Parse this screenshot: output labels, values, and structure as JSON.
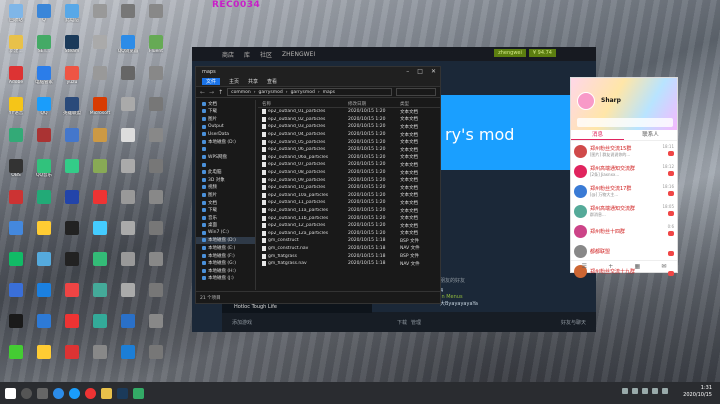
{
  "recording_label": "REC0034",
  "desktop_icons": [
    {
      "label": "回收站",
      "icon": "recycle-bin-icon",
      "color": "#7fb6e8"
    },
    {
      "label": "Q",
      "icon": "app-icon",
      "color": "#3a86d9"
    },
    {
      "label": "此电脑",
      "icon": "this-pc-icon",
      "color": "#58a8e8"
    },
    {
      "label": "",
      "icon": "app-icon",
      "color": "#999"
    },
    {
      "label": "",
      "icon": "app-icon",
      "color": "#777"
    },
    {
      "label": "",
      "icon": "app-icon",
      "color": "#888"
    },
    {
      "label": "新建...",
      "icon": "folder-icon",
      "color": "#e8c14a"
    },
    {
      "label": "SET...",
      "icon": "app-icon",
      "color": "#4a6"
    },
    {
      "label": "Steam",
      "icon": "steam-icon",
      "color": "#1b3a5a"
    },
    {
      "label": "",
      "icon": "app-icon",
      "color": "#aaa"
    },
    {
      "label": "QQ浏览器",
      "icon": "browser-icon",
      "color": "#2c8ce8"
    },
    {
      "label": "Fluent",
      "icon": "app-icon",
      "color": "#6a5"
    },
    {
      "label": "Adobe",
      "icon": "adobe-icon",
      "color": "#d33"
    },
    {
      "label": "电脑管家",
      "icon": "app-icon",
      "color": "#2b7de9"
    },
    {
      "label": "yuzu",
      "icon": "app-icon",
      "color": "#e54"
    },
    {
      "label": "",
      "icon": "app-icon",
      "color": "#999"
    },
    {
      "label": "",
      "icon": "app-icon",
      "color": "#666"
    },
    {
      "label": "",
      "icon": "app-icon",
      "color": "#888"
    },
    {
      "label": "YY语音",
      "icon": "app-icon",
      "color": "#f5c518"
    },
    {
      "label": "QQ",
      "icon": "qq-icon",
      "color": "#1a9dfb"
    },
    {
      "label": "英雄联盟",
      "icon": "game-icon",
      "color": "#2a4a7a"
    },
    {
      "label": "Microsoft",
      "icon": "app-icon",
      "color": "#d83b01"
    },
    {
      "label": "",
      "icon": "app-icon",
      "color": "#aaa"
    },
    {
      "label": "",
      "icon": "app-icon",
      "color": "#777"
    },
    {
      "label": "",
      "icon": "app-icon",
      "color": "#3a7"
    },
    {
      "label": "",
      "icon": "app-icon",
      "color": "#a33"
    },
    {
      "label": "",
      "icon": "app-icon",
      "color": "#47c"
    },
    {
      "label": "",
      "icon": "app-icon",
      "color": "#c94"
    },
    {
      "label": "",
      "icon": "app-icon",
      "color": "#ddd"
    },
    {
      "label": "",
      "icon": "app-icon",
      "color": "#888"
    },
    {
      "label": "OBS",
      "icon": "obs-icon",
      "color": "#333"
    },
    {
      "label": "QQ音乐",
      "icon": "music-icon",
      "color": "#31c27c"
    },
    {
      "label": "",
      "icon": "app-icon",
      "color": "#3c8"
    },
    {
      "label": "",
      "icon": "app-icon",
      "color": "#8a5"
    },
    {
      "label": "",
      "icon": "app-icon",
      "color": "#aaa"
    },
    {
      "label": "",
      "icon": "app-icon",
      "color": "#777"
    },
    {
      "label": "",
      "icon": "app-icon",
      "color": "#c33"
    },
    {
      "label": "",
      "icon": "app-icon",
      "color": "#2a7"
    },
    {
      "label": "",
      "icon": "app-icon",
      "color": "#24a"
    },
    {
      "label": "",
      "icon": "app-icon",
      "color": "#e33"
    },
    {
      "label": "",
      "icon": "app-icon",
      "color": "#999"
    },
    {
      "label": "",
      "icon": "app-icon",
      "color": "#888"
    },
    {
      "label": "",
      "icon": "app-icon",
      "color": "#48d"
    },
    {
      "label": "",
      "icon": "app-icon",
      "color": "#fc3"
    },
    {
      "label": "",
      "icon": "app-icon",
      "color": "#222"
    },
    {
      "label": "",
      "icon": "app-icon",
      "color": "#4cf"
    },
    {
      "label": "",
      "icon": "app-icon",
      "color": "#aaa"
    },
    {
      "label": "",
      "icon": "app-icon",
      "color": "#777"
    },
    {
      "label": "",
      "icon": "app-icon",
      "color": "#1b6"
    },
    {
      "label": "",
      "icon": "app-icon",
      "color": "#5ad"
    },
    {
      "label": "",
      "icon": "app-icon",
      "color": "#222"
    },
    {
      "label": "",
      "icon": "app-icon",
      "color": "#3b7"
    },
    {
      "label": "",
      "icon": "app-icon",
      "color": "#999"
    },
    {
      "label": "",
      "icon": "app-icon",
      "color": "#888"
    },
    {
      "label": "",
      "icon": "app-icon",
      "color": "#3a6fd8"
    },
    {
      "label": "",
      "icon": "app-icon",
      "color": "#1b80e0"
    },
    {
      "label": "",
      "icon": "app-icon",
      "color": "#e44"
    },
    {
      "label": "",
      "icon": "app-icon",
      "color": "#4a9"
    },
    {
      "label": "",
      "icon": "app-icon",
      "color": "#aaa"
    },
    {
      "label": "",
      "icon": "app-icon",
      "color": "#777"
    },
    {
      "label": "",
      "icon": "app-icon",
      "color": "#1a1a1a"
    },
    {
      "label": "",
      "icon": "app-icon",
      "color": "#2d7ad6"
    },
    {
      "label": "",
      "icon": "app-icon",
      "color": "#e33"
    },
    {
      "label": "",
      "icon": "app-icon",
      "color": "#3a9"
    },
    {
      "label": "",
      "icon": "app-icon",
      "color": "#2a70c8"
    },
    {
      "label": "",
      "icon": "app-icon",
      "color": "#888"
    },
    {
      "label": "",
      "icon": "app-icon",
      "color": "#4c3"
    },
    {
      "label": "",
      "icon": "app-icon",
      "color": "#fc3"
    },
    {
      "label": "",
      "icon": "app-icon",
      "color": "#d33"
    },
    {
      "label": "",
      "icon": "app-icon",
      "color": "#888"
    },
    {
      "label": "",
      "icon": "app-icon",
      "color": "#1c7ed6"
    },
    {
      "label": "",
      "icon": "app-icon",
      "color": "#777"
    }
  ],
  "steam": {
    "menu": [
      "商店",
      "库",
      "社区",
      "ZHENGWEI"
    ],
    "user_badge": "zhengwei",
    "balance": "¥ 94.74",
    "game_title": "ry's mod",
    "friends_header": "朋友的好友",
    "friends": [
      {
        "name": "4",
        "status": ""
      },
      {
        "name": "In Menus",
        "status": ""
      },
      {
        "name": "大ByayayayaYa",
        "status": ""
      }
    ],
    "bottom_left": "添加游戏",
    "bottom_center": "下载",
    "bottom_center_sub": "管理",
    "bottom_right_label": "好友与聊天"
  },
  "hotbar_text": "Hotloc Tough Life",
  "explorer": {
    "title": "maps",
    "ribbon_tabs": [
      "文件",
      "主页",
      "共享",
      "查看"
    ],
    "path": [
      "common",
      "garrysmod",
      "garrysmod",
      "maps"
    ],
    "nav": [
      {
        "label": "文档",
        "active": false
      },
      {
        "label": "下载",
        "active": false
      },
      {
        "label": "图片",
        "active": false
      },
      {
        "label": "Output",
        "active": false
      },
      {
        "label": "UserData",
        "active": false
      },
      {
        "label": "本地磁盘 (D:)",
        "active": false
      },
      {
        "label": "",
        "active": false
      },
      {
        "label": "WPS网盘",
        "active": false
      },
      {
        "label": "",
        "active": false
      },
      {
        "label": "此电脑",
        "active": false
      },
      {
        "label": "3D 对象",
        "active": false
      },
      {
        "label": "视频",
        "active": false
      },
      {
        "label": "图片",
        "active": false
      },
      {
        "label": "文档",
        "active": false
      },
      {
        "label": "下载",
        "active": false
      },
      {
        "label": "音乐",
        "active": false
      },
      {
        "label": "桌面",
        "active": false
      },
      {
        "label": "Win7 (C:)",
        "active": false
      },
      {
        "label": "本地磁盘 (D:)",
        "active": true
      },
      {
        "label": "本地磁盘 (E:)",
        "active": false
      },
      {
        "label": "本地磁盘 (F:)",
        "active": false
      },
      {
        "label": "本地磁盘 (G:)",
        "active": false
      },
      {
        "label": "本地磁盘 (H:)",
        "active": false
      },
      {
        "label": "本地磁盘 (J:)",
        "active": false
      }
    ],
    "columns": [
      "名称",
      "修改日期",
      "类型"
    ],
    "files": [
      {
        "name": "ep2_outland_01_particles",
        "date": "2020/10/15 1:20",
        "type": "文本文档"
      },
      {
        "name": "ep2_outland_02_particles",
        "date": "2020/10/15 1:20",
        "type": "文本文档"
      },
      {
        "name": "ep2_outland_03_particles",
        "date": "2020/10/15 1:20",
        "type": "文本文档"
      },
      {
        "name": "ep2_outland_04_particles",
        "date": "2020/10/15 1:20",
        "type": "文本文档"
      },
      {
        "name": "ep2_outland_05_particles",
        "date": "2020/10/15 1:20",
        "type": "文本文档"
      },
      {
        "name": "ep2_outland_06_particles",
        "date": "2020/10/15 1:20",
        "type": "文本文档"
      },
      {
        "name": "ep2_outland_06a_particles",
        "date": "2020/10/15 1:20",
        "type": "文本文档"
      },
      {
        "name": "ep2_outland_07_particles",
        "date": "2020/10/15 1:20",
        "type": "文本文档"
      },
      {
        "name": "ep2_outland_08_particles",
        "date": "2020/10/15 1:20",
        "type": "文本文档"
      },
      {
        "name": "ep2_outland_09_particles",
        "date": "2020/10/15 1:20",
        "type": "文本文档"
      },
      {
        "name": "ep2_outland_10_particles",
        "date": "2020/10/15 1:20",
        "type": "文本文档"
      },
      {
        "name": "ep2_outland_10a_particles",
        "date": "2020/10/15 1:20",
        "type": "文本文档"
      },
      {
        "name": "ep2_outland_11_particles",
        "date": "2020/10/15 1:20",
        "type": "文本文档"
      },
      {
        "name": "ep2_outland_11a_particles",
        "date": "2020/10/15 1:20",
        "type": "文本文档"
      },
      {
        "name": "ep2_outland_11b_particles",
        "date": "2020/10/15 1:20",
        "type": "文本文档"
      },
      {
        "name": "ep2_outland_12_particles",
        "date": "2020/10/15 1:20",
        "type": "文本文档"
      },
      {
        "name": "ep2_outland_12a_particles",
        "date": "2020/10/15 1:20",
        "type": "文本文档"
      },
      {
        "name": "gm_construct",
        "date": "2020/10/15 1:18",
        "type": "BSP 文件"
      },
      {
        "name": "gm_construct.nav",
        "date": "2020/10/15 1:18",
        "type": "NAV 文件"
      },
      {
        "name": "gm_flatgrass",
        "date": "2020/10/15 1:18",
        "type": "BSP 文件"
      },
      {
        "name": "gm_flatgrass.nav",
        "date": "2020/10/15 1:18",
        "type": "NAV 文件"
      }
    ],
    "status": "21 个项目"
  },
  "qq": {
    "name": "Sharp",
    "tabs": [
      "消息",
      "联系人"
    ],
    "chats": [
      {
        "name": "郑州粉丝交流15群",
        "msg": "[图片] 群友说说你的...",
        "time": "18:11",
        "color": "#d04a4a"
      },
      {
        "name": "郑州高端通知交流群",
        "msg": "[2条] Jiaxnxx...",
        "time": "18:12",
        "color": "#e0245e"
      },
      {
        "name": "郑州粉丝交流17群",
        "msg": "[@] 万物大主...",
        "time": "18:16",
        "color": "#3a7bd5"
      },
      {
        "name": "郑州高端通知交流群",
        "msg": "群消息...",
        "time": "18:05",
        "color": "#5a9"
      },
      {
        "name": "郑州粉丝十四群",
        "msg": "",
        "time": "0:6",
        "color": "#c48"
      },
      {
        "name": "都都联盟",
        "msg": "",
        "time": "",
        "color": "#888"
      },
      {
        "name": "郑州粉丝交流十九群",
        "msg": "",
        "time": "",
        "color": "#c63"
      }
    ]
  },
  "taskbar": {
    "time": "1:31",
    "date": "2020/10/15"
  }
}
